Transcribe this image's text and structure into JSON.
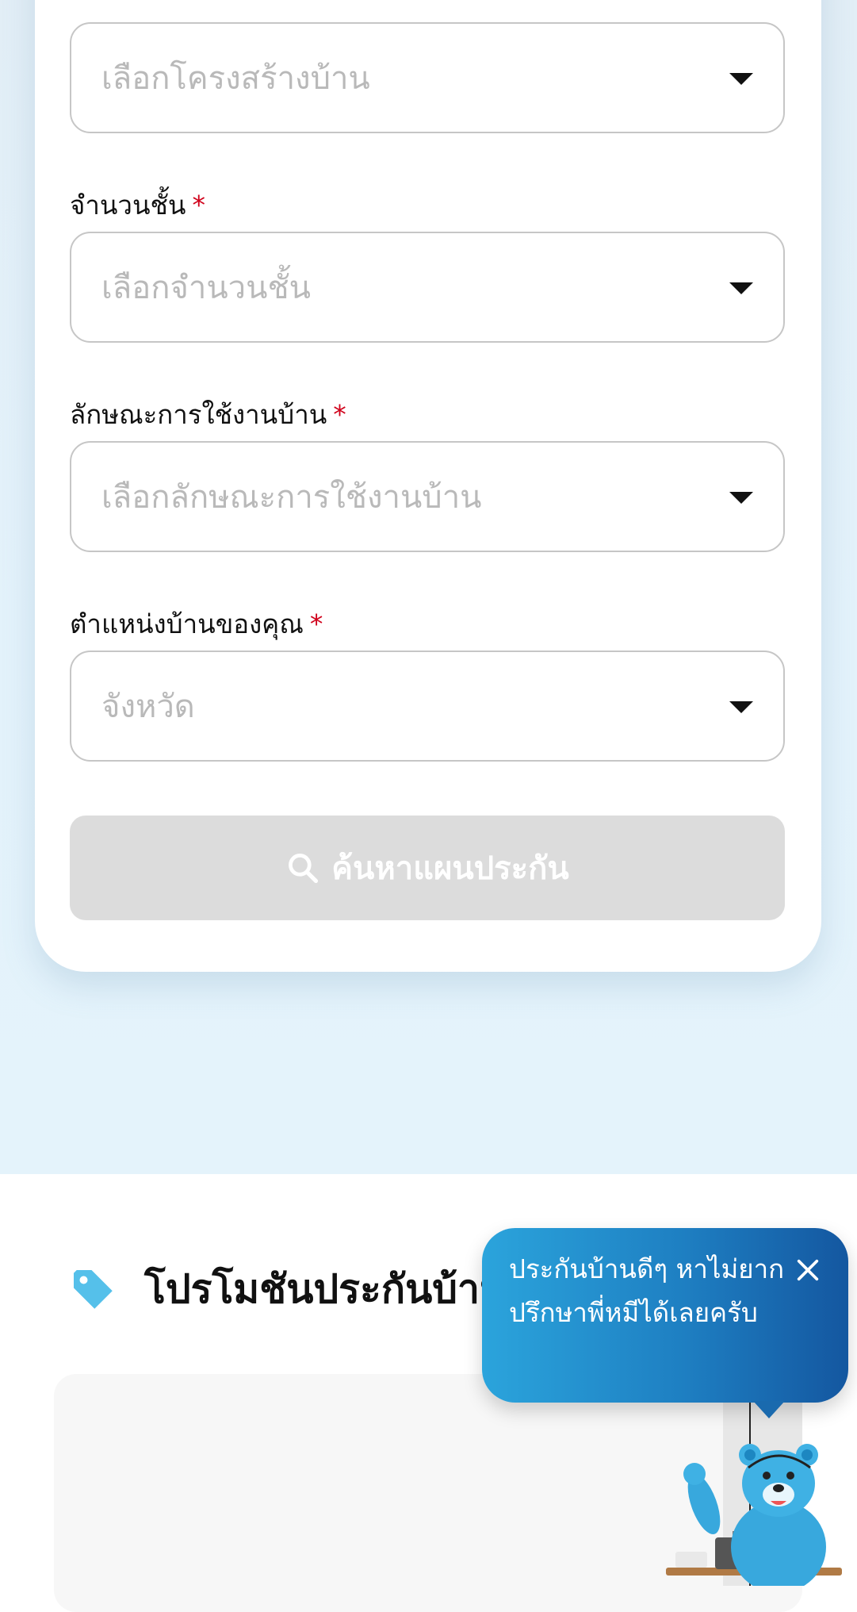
{
  "form": {
    "structure": {
      "placeholder": "เลือกโครงสร้างบ้าน"
    },
    "floors": {
      "label": "จำนวนชั้น",
      "placeholder": "เลือกจำนวนชั้น"
    },
    "usage": {
      "label": "ลักษณะการใช้งานบ้าน",
      "placeholder": "เลือกลักษณะการใช้งานบ้าน"
    },
    "location": {
      "label": "ตำแหน่งบ้านของคุณ",
      "placeholder": "จังหวัด"
    },
    "required_mark": "*",
    "search_button": "ค้นหาแผนประกัน"
  },
  "promotion": {
    "title": "โปรโมชันประกันบ้าน"
  },
  "chat": {
    "message": "ประกันบ้านดีๆ หาไม่ยาก ปรึกษาพี่หมีได้เลยครับ"
  },
  "colors": {
    "accent": "#2ba4dc",
    "required": "#d0021b",
    "disabled_button": "#dcdcdc",
    "tag_icon": "#55c0ea"
  }
}
